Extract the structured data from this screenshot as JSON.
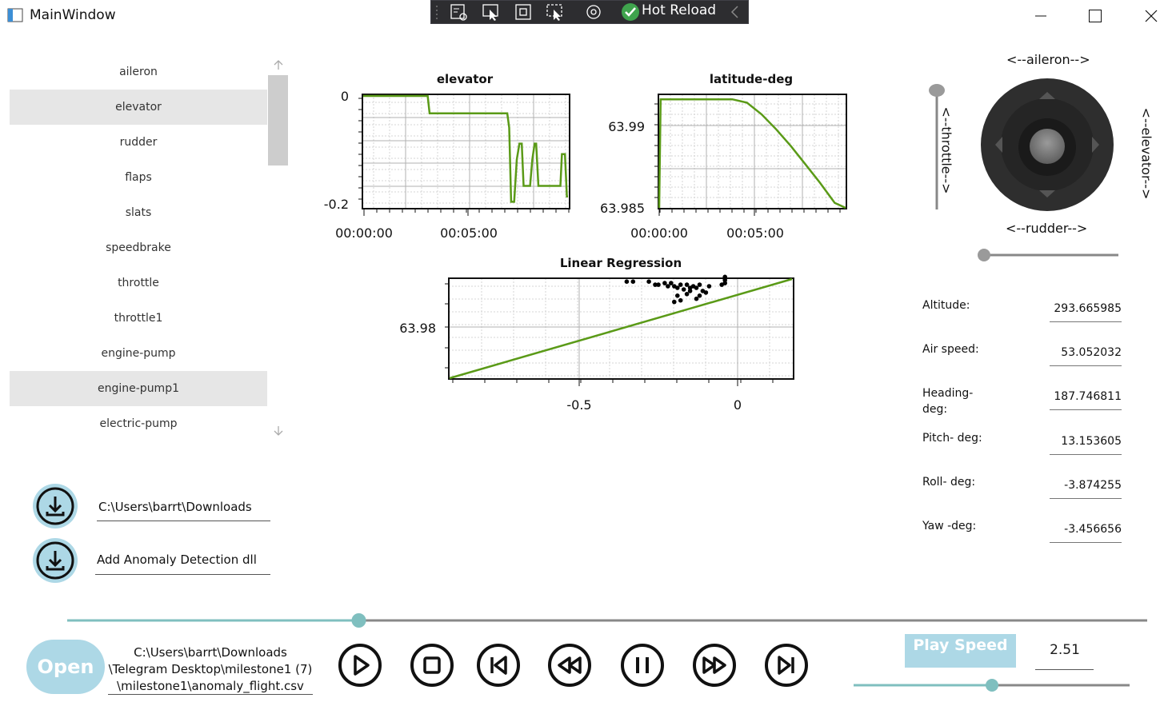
{
  "window": {
    "title": "MainWindow"
  },
  "toolbar": {
    "hot_reload_label": "Hot Reload"
  },
  "parameters": {
    "items": [
      {
        "label": "aileron"
      },
      {
        "label": "elevator"
      },
      {
        "label": "rudder"
      },
      {
        "label": "flaps"
      },
      {
        "label": "slats"
      },
      {
        "label": "speedbrake"
      },
      {
        "label": "throttle"
      },
      {
        "label": "throttle1"
      },
      {
        "label": "engine-pump"
      },
      {
        "label": "engine-pump1"
      },
      {
        "label": "electric-pump"
      }
    ],
    "selected": [
      "elevator",
      "engine-pump1"
    ]
  },
  "files": {
    "csv_path": "C:\\Users\\barrt\\Downloads",
    "dll_label": "Add Anomaly Detection dll"
  },
  "chart_data": [
    {
      "type": "line",
      "title": "elevator",
      "x_ticks": [
        "00:00:00",
        "00:05:00"
      ],
      "y_ticks": [
        "0",
        "-0.2"
      ],
      "ylim": [
        -0.21,
        0.0
      ],
      "series": [
        {
          "x": [
            0,
            170,
            175,
            380,
            385,
            390,
            398,
            405,
            412,
            418,
            423,
            428,
            434,
            440,
            446,
            452,
            456,
            462,
            468,
            474,
            480,
            486,
            490,
            496,
            502,
            508,
            514,
            520,
            524,
            528,
            532,
            537,
            540
          ],
          "y": [
            0,
            0,
            -0.033,
            -0.033,
            -0.06,
            -0.2,
            -0.2,
            -0.12,
            -0.09,
            -0.09,
            -0.17,
            -0.17,
            -0.17,
            -0.17,
            -0.12,
            -0.09,
            -0.09,
            -0.17,
            -0.17,
            -0.17,
            -0.17,
            -0.17,
            -0.17,
            -0.17,
            -0.17,
            -0.17,
            -0.17,
            -0.17,
            -0.11,
            -0.11,
            -0.11,
            -0.19,
            -0.19
          ]
        }
      ]
    },
    {
      "type": "line",
      "title": "latitude-deg",
      "x_ticks": [
        "00:00:00",
        "00:05:00"
      ],
      "y_ticks": [
        "63.99",
        "63.985"
      ],
      "ylim": [
        63.985,
        63.9917
      ],
      "series": [
        {
          "x": [
            0,
            4,
            40,
            80,
            120,
            160,
            200,
            240,
            280,
            320,
            360,
            400,
            440,
            480,
            520,
            560
          ],
          "y": [
            63.985,
            63.9915,
            63.9915,
            63.9915,
            63.9915,
            63.9915,
            63.9915,
            63.9913,
            63.9906,
            63.9897,
            63.9887,
            63.9876,
            63.9865,
            63.9853,
            63.9841,
            63.983
          ]
        }
      ]
    },
    {
      "type": "scatter",
      "title": "Linear Regression",
      "x_ticks": [
        "-0.5",
        "0"
      ],
      "y_ticks": [
        "63.98"
      ],
      "xlim": [
        -1.0,
        0.2
      ],
      "ylim": [
        63.974,
        63.984
      ],
      "regression": {
        "x": [
          -1.0,
          0.2
        ],
        "y": [
          63.974,
          63.984
        ]
      },
      "points": {
        "x": [
          -0.35,
          -0.33,
          -0.28,
          -0.26,
          -0.25,
          -0.23,
          -0.22,
          -0.21,
          -0.2,
          -0.19,
          -0.18,
          -0.17,
          -0.16,
          -0.15,
          -0.14,
          -0.13,
          -0.12,
          -0.11,
          -0.1,
          -0.09,
          -0.2,
          -0.19,
          -0.18,
          -0.16,
          -0.15,
          -0.13,
          -0.12,
          -0.05,
          -0.04,
          -0.04,
          -0.04
        ],
        "y": [
          63.9829,
          63.9829,
          63.9829,
          63.9827,
          63.9827,
          63.9828,
          63.9826,
          63.9828,
          63.9826,
          63.9825,
          63.9827,
          63.9824,
          63.9827,
          63.9825,
          63.9826,
          63.9825,
          63.9827,
          63.9823,
          63.9822,
          63.9826,
          63.9816,
          63.982,
          63.9817,
          63.9821,
          63.9823,
          63.9818,
          63.982,
          63.9827,
          63.983,
          63.9832,
          63.9828
        ]
      }
    }
  ],
  "joystick": {
    "top_label": "<--aileron-->",
    "bottom_label": "<--rudder-->",
    "left_label": "<--throttle-->",
    "right_label": "<--elevator-->",
    "throttle_level": 1.0,
    "rudder_level": 0.0
  },
  "flight_info": [
    {
      "label": "Altitude:",
      "value": "293.665985"
    },
    {
      "label": "Air speed:",
      "value": "53.052032"
    },
    {
      "label": "Heading-\ndeg:",
      "value": "187.746811"
    },
    {
      "label": "Pitch- deg:",
      "value": "13.153605"
    },
    {
      "label": "Roll- deg:",
      "value": "-3.874255"
    },
    {
      "label": "Yaw -deg:",
      "value": "-3.456656"
    }
  ],
  "playback": {
    "open_label": "Open",
    "file_path": "C:\\Users\\barrt\\Downloads\n\\Telegram Desktop\\milestone1 (7)\n\\milestone1\\anomaly_flight.csv",
    "progress": 0.27,
    "speed_label": "Play Speed",
    "speed_value": "2.51",
    "speed_level": 0.5
  },
  "colors": {
    "accent": "#add8e6",
    "slider": "#7fbfbf",
    "line": "#5a9a17"
  },
  "icons": [
    "download-icon",
    "play-icon",
    "stop-icon",
    "skip-back-icon",
    "rewind-icon",
    "pause-icon",
    "fast-forward-icon",
    "skip-forward-icon"
  ]
}
